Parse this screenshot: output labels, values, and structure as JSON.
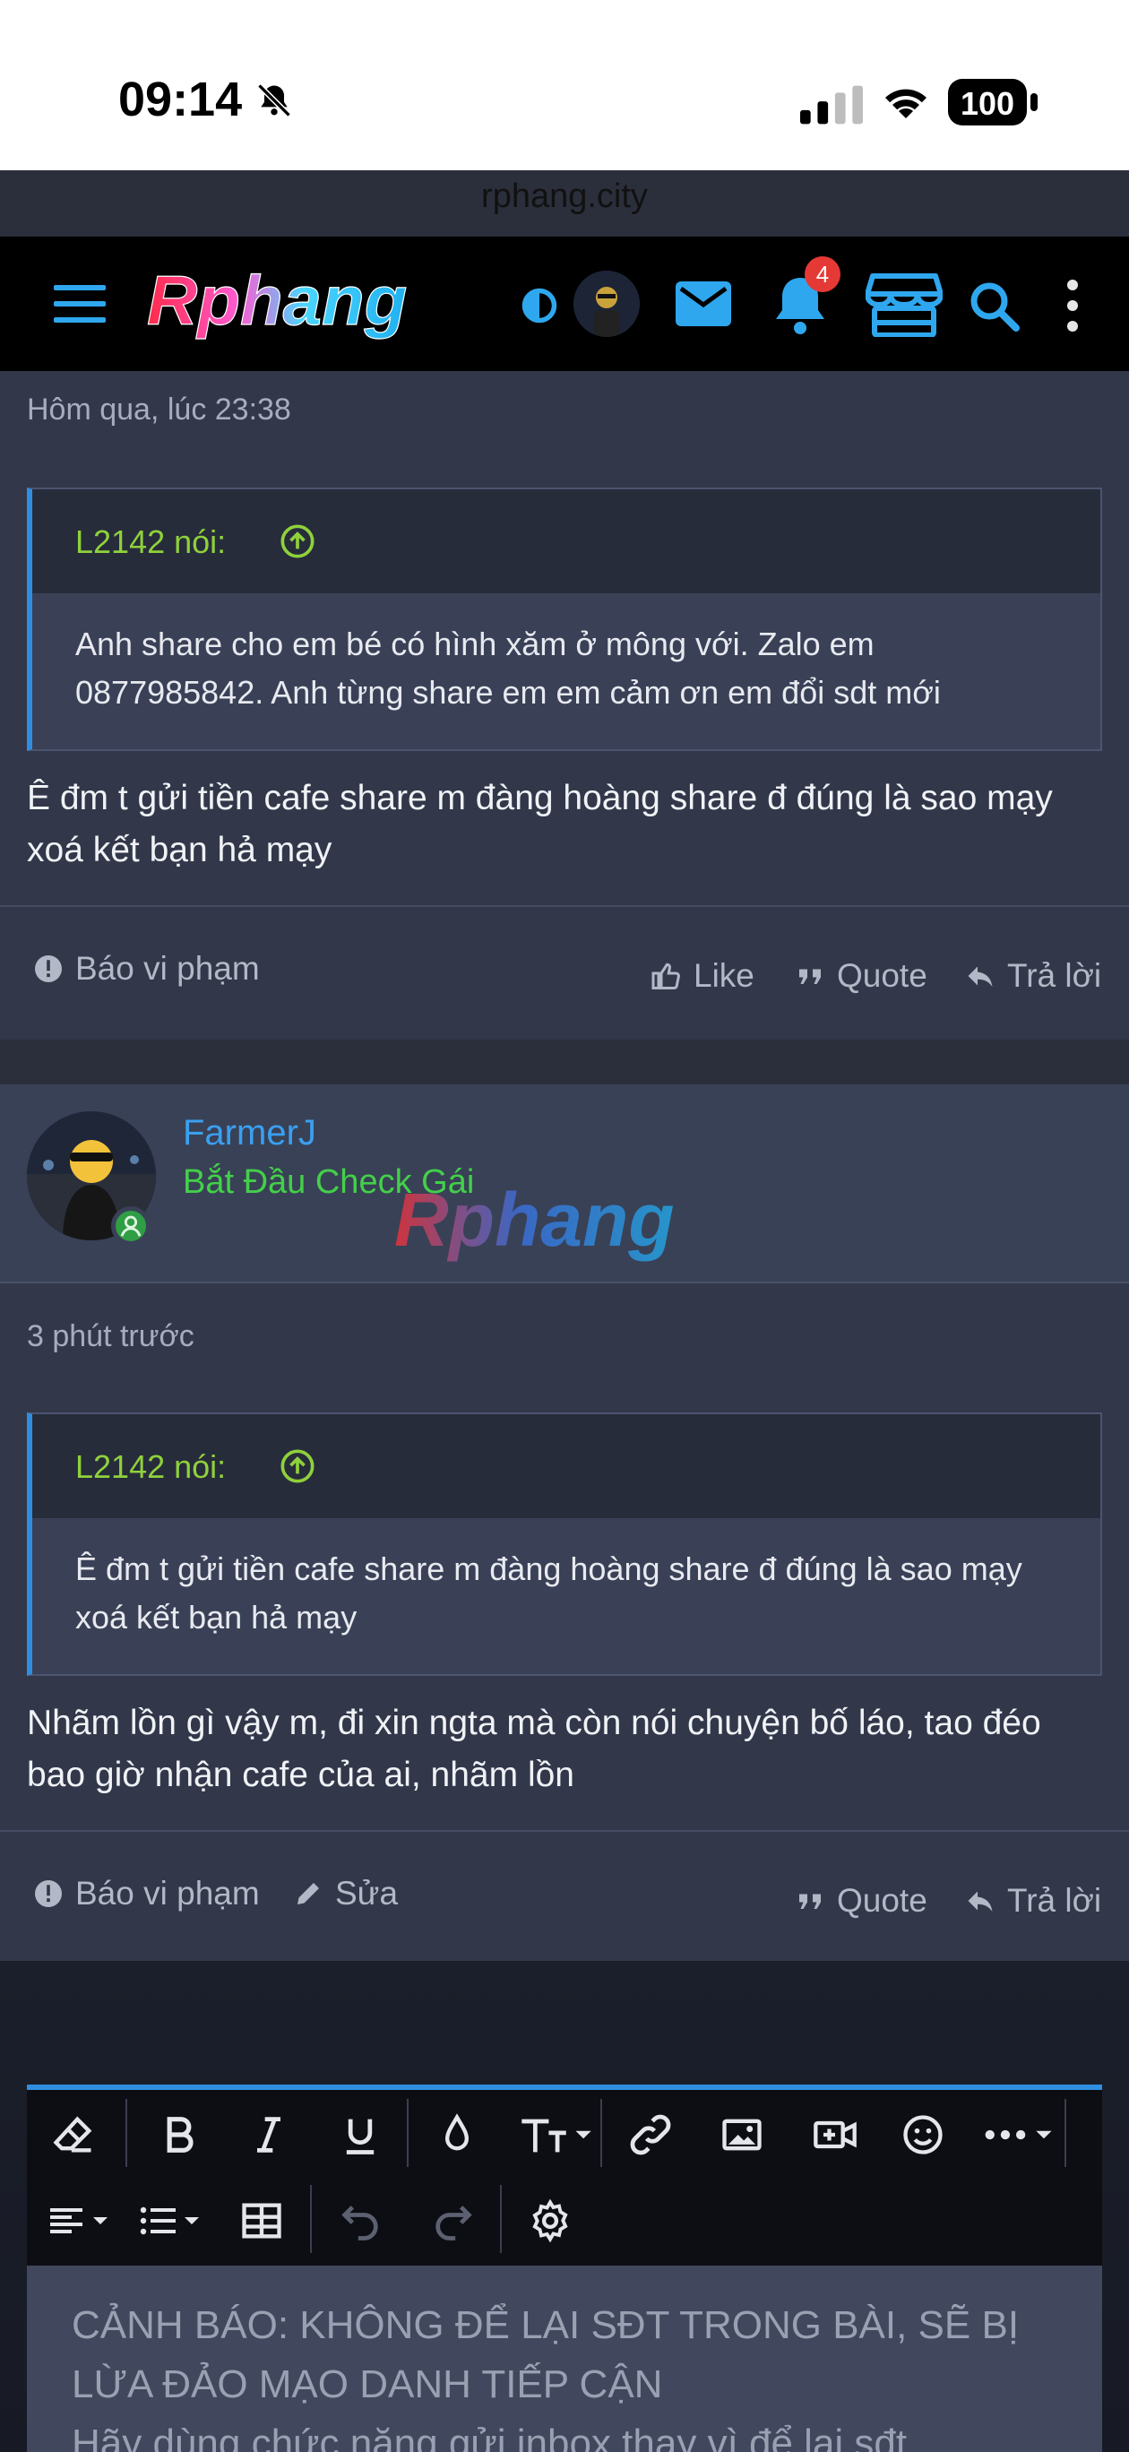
{
  "status_bar": {
    "time": "09:14",
    "battery": "100"
  },
  "browser": {
    "url": "rphang.city"
  },
  "nav": {
    "logo_text": "Rphang",
    "notification_count": "4"
  },
  "posts": [
    {
      "date": "Hôm qua, lúc 23:38",
      "quote_author": "L2142 nói:",
      "quote_text": "Anh share cho em bé có hình xăm ở mông với. Zalo em 0877985842. Anh từng share em em cảm ơn em đổi sdt mới",
      "text": "Ê đm t gửi tiền cafe share m đàng hoàng share đ đúng là sao mạy xoá kết bạn hả mạy",
      "actions": {
        "report": "Báo vi phạm",
        "like": "Like",
        "quote": "Quote",
        "reply": "Trả lời"
      }
    },
    {
      "username": "FarmerJ",
      "user_title": "Bắt Đầu Check Gái",
      "watermark": "Rphang",
      "date": "3 phút trước",
      "quote_author": "L2142 nói:",
      "quote_text": "Ê đm t gửi tiền cafe share m đàng hoàng share đ đúng là sao mạy xoá kết bạn hả mạy",
      "text": "Nhãm lồn gì vậy m, đi xin ngta mà còn nói chuyện bố láo, tao đéo bao giờ nhận cafe của ai, nhãm lồn",
      "actions": {
        "report": "Báo vi phạm",
        "edit": "Sửa",
        "quote": "Quote",
        "reply": "Trả lời"
      }
    }
  ],
  "editor": {
    "placeholder": "CẢNH BÁO: KHÔNG ĐỂ LẠI SĐT TRONG BÀI, SẼ BỊ LỪA ĐẢO MẠO DANH TIẾP CẬN\nHãy dùng chức năng gửi inbox thay vì để lại sđt"
  },
  "colors": {
    "accent": "#2f8ee0",
    "username": "#3aa0f0",
    "user_title": "#43d049",
    "quote_author": "#8fd13b",
    "nav_icons": "#2fa7ee"
  }
}
